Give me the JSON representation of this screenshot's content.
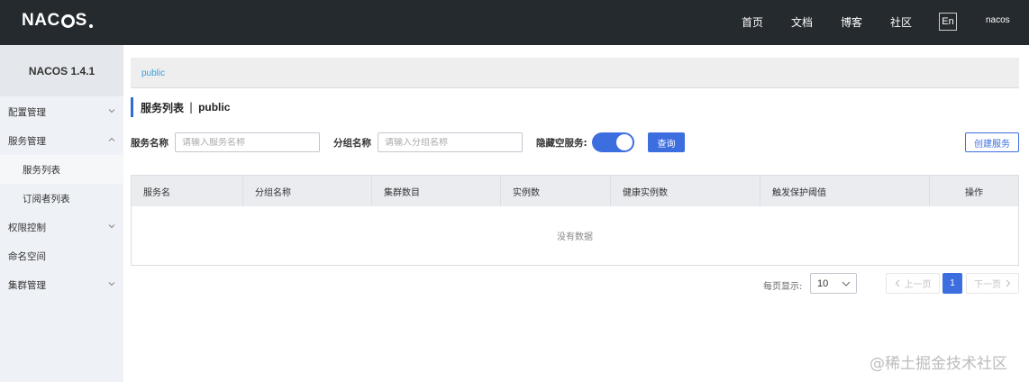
{
  "header": {
    "logo_text_1": "NAC",
    "logo_text_2": "S",
    "nav": [
      "首页",
      "文档",
      "博客",
      "社区"
    ],
    "lang": "En",
    "user": "nacos"
  },
  "sidebar": {
    "title": "NACOS 1.4.1",
    "items": [
      {
        "label": "配置管理"
      },
      {
        "label": "服务管理"
      },
      {
        "label": "服务列表"
      },
      {
        "label": "订阅者列表"
      },
      {
        "label": "权限控制"
      },
      {
        "label": "命名空间"
      },
      {
        "label": "集群管理"
      }
    ]
  },
  "breadcrumb": "public",
  "page": {
    "title": "服务列表",
    "separator": "|",
    "namespace": "public"
  },
  "filters": {
    "service_name_label": "服务名称",
    "service_name_placeholder": "请输入服务名称",
    "group_name_label": "分组名称",
    "group_name_placeholder": "请输入分组名称",
    "hide_empty_label": "隐藏空服务:",
    "hide_empty_on": true,
    "query_button": "查询",
    "create_button": "创建服务"
  },
  "table": {
    "columns": [
      "服务名",
      "分组名称",
      "集群数目",
      "实例数",
      "健康实例数",
      "触发保护阈值",
      "操作"
    ],
    "empty_text": "没有数据"
  },
  "pagination": {
    "page_size_label": "每页显示:",
    "page_size": "10",
    "prev": "上一页",
    "next": "下一页",
    "current": "1"
  },
  "watermark": "@稀土掘金技术社区",
  "colors": {
    "header_bg": "#252a2f",
    "primary": "#3d6ee0",
    "sidebar_bg": "#eef1f6"
  }
}
